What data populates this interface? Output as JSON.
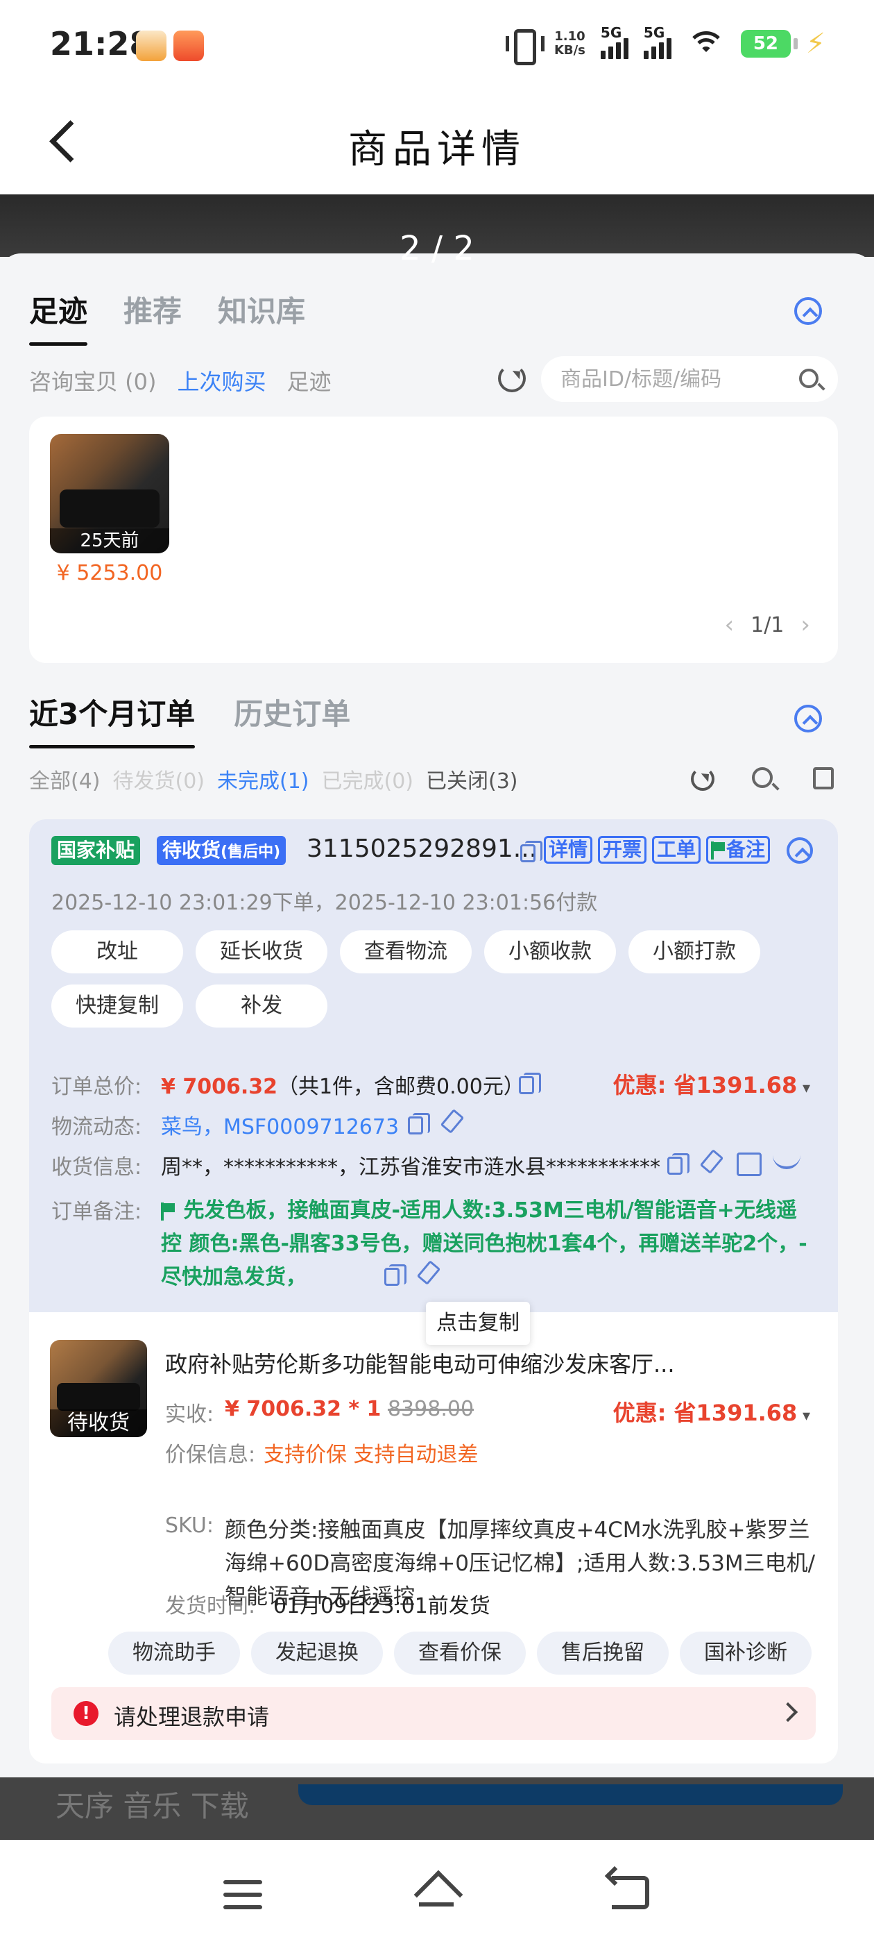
{
  "status_bar": {
    "time": "21:28",
    "net_speed_value": "1.10",
    "net_speed_unit": "KB/s",
    "signal1_label": "5G",
    "signal2_label": "5G",
    "battery": "52",
    "icons": [
      "app-icon-1",
      "app-icon-2",
      "vibrate-icon",
      "signal-icon",
      "wifi-icon",
      "battery-icon",
      "charging-bolt-icon"
    ]
  },
  "header": {
    "title": "商品详情",
    "back_icon": "back-arrow-icon"
  },
  "image_counter": "2 / 2",
  "panel": {
    "tabs": [
      {
        "label": "足迹",
        "active": true
      },
      {
        "label": "推荐",
        "active": false
      },
      {
        "label": "知识库",
        "active": false
      }
    ],
    "subfilters": [
      {
        "label": "咨询宝贝 (0)",
        "selected": false
      },
      {
        "label": "上次购买",
        "selected": true
      },
      {
        "label": "足迹",
        "selected": false
      }
    ],
    "search_placeholder": "商品ID/标题/编码",
    "footprint": {
      "badge": "25天前",
      "price": "¥ 5253.00",
      "pager": "1/1",
      "prev": "‹",
      "next": "›"
    }
  },
  "orders": {
    "tabs": [
      {
        "label": "近3个月订单",
        "active": true
      },
      {
        "label": "历史订单",
        "active": false
      }
    ],
    "status_filters": [
      {
        "label": "全部(4)",
        "style": "normal"
      },
      {
        "label": "待发货(0)",
        "style": "muted"
      },
      {
        "label": "未完成(1)",
        "style": "selected"
      },
      {
        "label": "已完成(0)",
        "style": "muted"
      },
      {
        "label": "已关闭(3)",
        "style": "dark"
      }
    ],
    "card": {
      "tag_subsidy": "国家补贴",
      "tag_status": "待收货",
      "tag_status_sub": "(售后中)",
      "order_no": "3115025292891...",
      "btn_detail": "详情",
      "btn_invoice": "开票",
      "btn_ticket": "工单",
      "btn_remark": "备注",
      "time_line": "2025-12-10 23:01:29下单，2025-12-10 23:01:56付款",
      "action_pills": [
        "改址",
        "延长收货",
        "查看物流",
        "小额收款",
        "小额打款",
        "快捷复制",
        "补发"
      ],
      "total_label": "订单总价:",
      "total_amount": "¥ 7006.32",
      "total_detail": "（共1件，含邮费0.00元）",
      "discount": "优惠: 省1391.68",
      "logistics_label": "物流动态:",
      "logistics_value": "菜鸟，MSF0009712673",
      "address_label": "收货信息:",
      "address_value": "周**，***********，江苏省淮安市涟水县***********",
      "remark_label": "订单备注:",
      "remark_value": "先发色板，接触面真皮-适用人数:3.53M三电机/智能语音+无线遥控 颜色:黑色-鼎客33号色，赠送同色抱枕1套4个，再赠送羊驼2个，-尽快加急发货，",
      "tooltip": "点击复制",
      "product": {
        "badge": "待收货",
        "title": "政府补贴劳伦斯多功能智能电动可伸缩沙发床客厅...",
        "paid_label": "实收:",
        "paid_value": "¥ 7006.32 * 1",
        "original_price": "8398.00",
        "discount": "优惠: 省1391.68",
        "protect_label": "价保信息:",
        "protect_1": "支持价保",
        "protect_2": "支持自动退差",
        "sku_label": "SKU:",
        "sku_value": "颜色分类:接触面真皮【加厚摔纹真皮+4CM水洗乳胶+紫罗兰海绵+60D高密度海绵+0压记忆棉】;适用人数:3.53M三电机/智能语音+无线遥控",
        "ship_label": "发货时间:",
        "ship_value": "01月09日23:01前发货"
      },
      "bottom_actions": [
        "物流助手",
        "发起退换",
        "查看价保",
        "售后挽留",
        "国补诊断"
      ],
      "refund_alert": "请处理退款申请"
    }
  },
  "background_peek": "天序 音乐 下载",
  "nav_icons": [
    "menu-icon",
    "home-icon",
    "back-icon"
  ],
  "colors": {
    "accent_blue": "#3b82f6",
    "price_orange": "#f26522",
    "discount_red": "#e8432e",
    "green": "#19a15f",
    "order_bg": "#e5e9f5"
  }
}
